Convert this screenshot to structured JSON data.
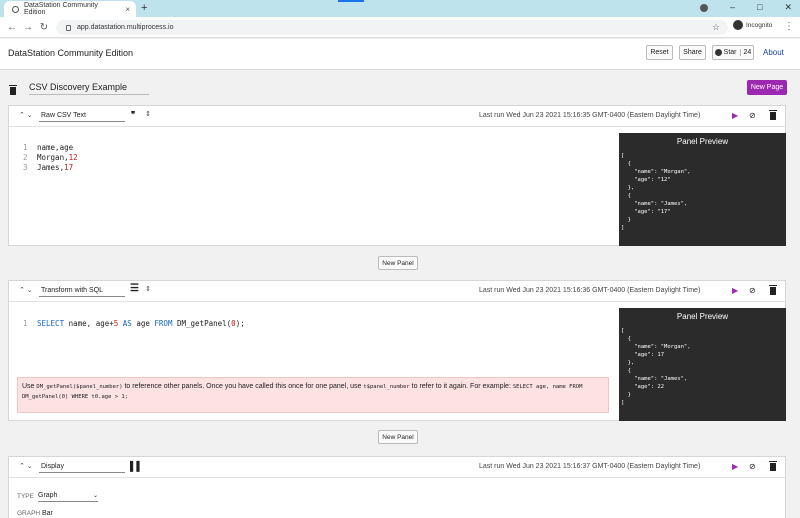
{
  "browser": {
    "tab_title": "DataStation Community Edition",
    "tab_close": "×",
    "new_tab": "+",
    "url": "app.datastation.multiprocess.io",
    "profile": "Incognito"
  },
  "header": {
    "app_name": "DataStation Community Edition",
    "reset_label": "Reset",
    "share_label": "Share",
    "star_label": "Star",
    "star_count": "24",
    "about_label": "About"
  },
  "page": {
    "title": "CSV Discovery Example",
    "new_page_label": "New Page"
  },
  "panels": [
    {
      "name": "Raw CSV Text",
      "last_run": "Last run Wed Jun 23 2021 15:16:35 GMT-0400 (Eastern Daylight Time)",
      "code_lines": [
        {
          "num": "1",
          "text": "name,age"
        },
        {
          "num": "2",
          "pre": "Morgan,",
          "value": "12"
        },
        {
          "num": "3",
          "pre": "James,",
          "value": "17"
        }
      ],
      "preview_title": "Panel Preview",
      "preview_text": "[\n  {\n    \"name\": \"Morgan\",\n    \"age\": \"12\"\n  },\n  {\n    \"name\": \"James\",\n    \"age\": \"17\"\n  }\n]"
    },
    {
      "name": "Transform with SQL",
      "last_run": "Last run Wed Jun 23 2021 15:16:36 GMT-0400 (Eastern Daylight Time)",
      "code_line": {
        "num": "1",
        "kw1": "SELECT",
        "p1": " name, age+",
        "n": "5",
        "kw2": " AS",
        "p2": " age ",
        "kw3": "FROM",
        "p3": " DM_getPanel(",
        "n2": "0",
        "p4": ");"
      },
      "hint": {
        "t1": "Use ",
        "c1": "DM_getPanel($panel_number)",
        "t2": " to reference other panels. Once you have called this once for one panel, use ",
        "c2": "t$panel_number",
        "t3": " to refer to it again. For example: ",
        "c3": "SELECT age, name FROM DM_getPanel(0) WHERE t0.age > 1;"
      },
      "preview_title": "Panel Preview",
      "preview_text": "[\n  {\n    \"name\": \"Morgan\",\n    \"age\": 17\n  },\n  {\n    \"name\": \"James\",\n    \"age\": 22\n  }\n]"
    },
    {
      "name": "Display",
      "last_run": "Last run Wed Jun 23 2021 15:16:37 GMT-0400 (Eastern Daylight Time)",
      "type_label": "TYPE",
      "type_value": "Graph",
      "graph_label": "GRAPH",
      "graph_value": "Bar"
    }
  ],
  "new_panel_label": "New Panel",
  "colors": {
    "accent": "#9c27b0",
    "preview_bg": "#2b2b2b",
    "hint_bg": "#fde2e2",
    "link": "#0d47a1"
  }
}
